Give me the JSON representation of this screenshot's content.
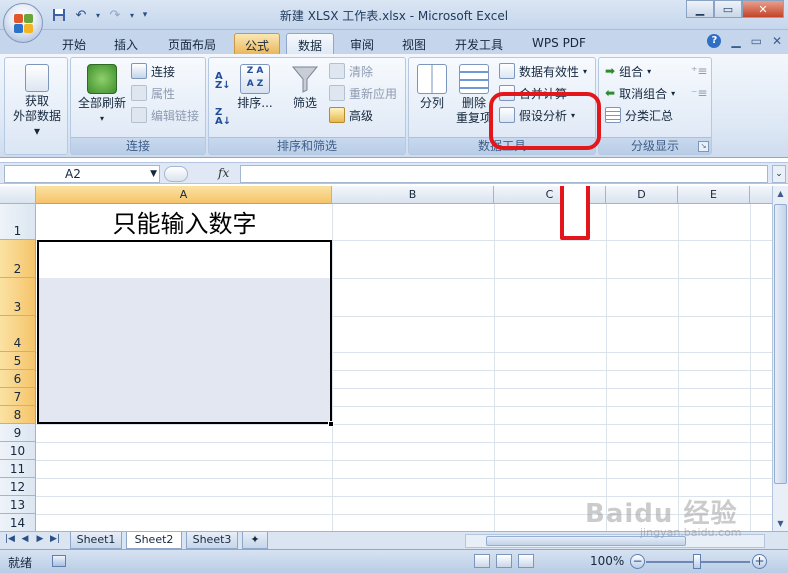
{
  "window": {
    "title": "新建 XLSX 工作表.xlsx - Microsoft Excel",
    "minimize": "▁",
    "restore": "▭",
    "close": "✕"
  },
  "qat": {
    "save_icon": "floppy-icon",
    "undo_icon": "undo-icon",
    "redo_icon": "redo-icon"
  },
  "tabs": [
    {
      "label": "开始"
    },
    {
      "label": "插入"
    },
    {
      "label": "页面布局"
    },
    {
      "label": "公式"
    },
    {
      "label": "数据"
    },
    {
      "label": "审阅"
    },
    {
      "label": "视图"
    },
    {
      "label": "开发工具"
    },
    {
      "label": "WPS PDF"
    }
  ],
  "active_tab": "数据",
  "ribbon": {
    "groups": {
      "get_external": {
        "label": "获取\n外部数据",
        "btn_line1": "获取",
        "btn_line2": "外部数据"
      },
      "connections": {
        "label": "连接",
        "refresh_all": "全部刷新",
        "connect": "连接",
        "properties": "属性",
        "edit_links": "编辑链接"
      },
      "sort_filter": {
        "label": "排序和筛选",
        "sort": "排序...",
        "filter": "筛选",
        "clear": "清除",
        "reapply": "重新应用",
        "advanced": "高级"
      },
      "data_tools": {
        "label": "数据工具",
        "text_to_columns": "分列",
        "remove_dup_1": "删除",
        "remove_dup_2": "重复项",
        "data_validation": "数据有效性",
        "consolidate": "合并计算",
        "what_if": "假设分析"
      },
      "outline": {
        "label": "分级显示",
        "group": "组合",
        "ungroup": "取消组合",
        "subtotal": "分类汇总"
      }
    }
  },
  "formula_bar": {
    "name_box": "A2",
    "fx": "fx",
    "content": ""
  },
  "columns": [
    "A",
    "B",
    "C",
    "D",
    "E"
  ],
  "rows": [
    "1",
    "2",
    "3",
    "4",
    "5",
    "6",
    "7",
    "8",
    "9",
    "10",
    "11",
    "12",
    "13",
    "14"
  ],
  "cells": {
    "A1": "只能输入数字"
  },
  "sheets": [
    "Sheet1",
    "Sheet2",
    "Sheet3"
  ],
  "active_sheet": "Sheet2",
  "status": {
    "ready": "就绪",
    "zoom": "100%",
    "zoom_minus": "−",
    "zoom_plus": "+"
  },
  "watermark": {
    "main": "Baidu 经验",
    "sub": "jingyan.baidu.com"
  },
  "colors": {
    "annotation": "#e3161c",
    "selection_fill": "#e3e7f2",
    "header_selected": "#f5c46b"
  }
}
